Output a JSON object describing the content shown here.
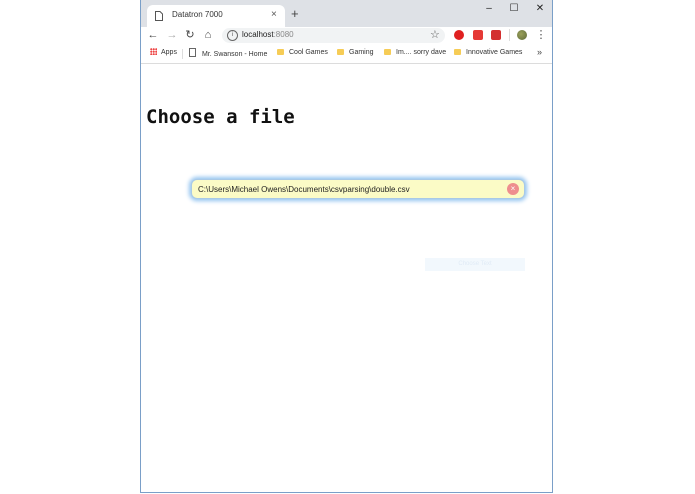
{
  "browser": {
    "tab_title": "Datatron 7000",
    "tab_close": "×",
    "new_tab": "+",
    "window_controls": {
      "minimize": "–",
      "maximize": "☐",
      "close": "✕"
    },
    "nav": {
      "back": "←",
      "forward": "→",
      "reload": "↻",
      "home": "⌂"
    },
    "url_host": "localhost",
    "url_port": ":8080",
    "star": "☆",
    "menu": "⋮",
    "bookmarks": [
      {
        "label": "Apps",
        "icon": "apps-grid-icon"
      },
      {
        "label": "Mr. Swanson - Home",
        "icon": "page-icon"
      },
      {
        "label": "Cool Games",
        "icon": "folder-icon"
      },
      {
        "label": "Gaming",
        "icon": "folder-icon"
      },
      {
        "label": "Im.... sorry dave",
        "icon": "folder-icon"
      },
      {
        "label": "Innovative Games",
        "icon": "folder-icon"
      }
    ],
    "bookmarks_more": "»",
    "extension_colors": [
      "#e02020",
      "#e53935",
      "#d32f2f"
    ]
  },
  "page": {
    "heading": "Choose a file",
    "file_path_value": "C:\\Users\\Michael Owens\\Documents\\csvparsing\\double.csv",
    "clear_symbol": "×",
    "choose_button_label": "Choose Text"
  }
}
